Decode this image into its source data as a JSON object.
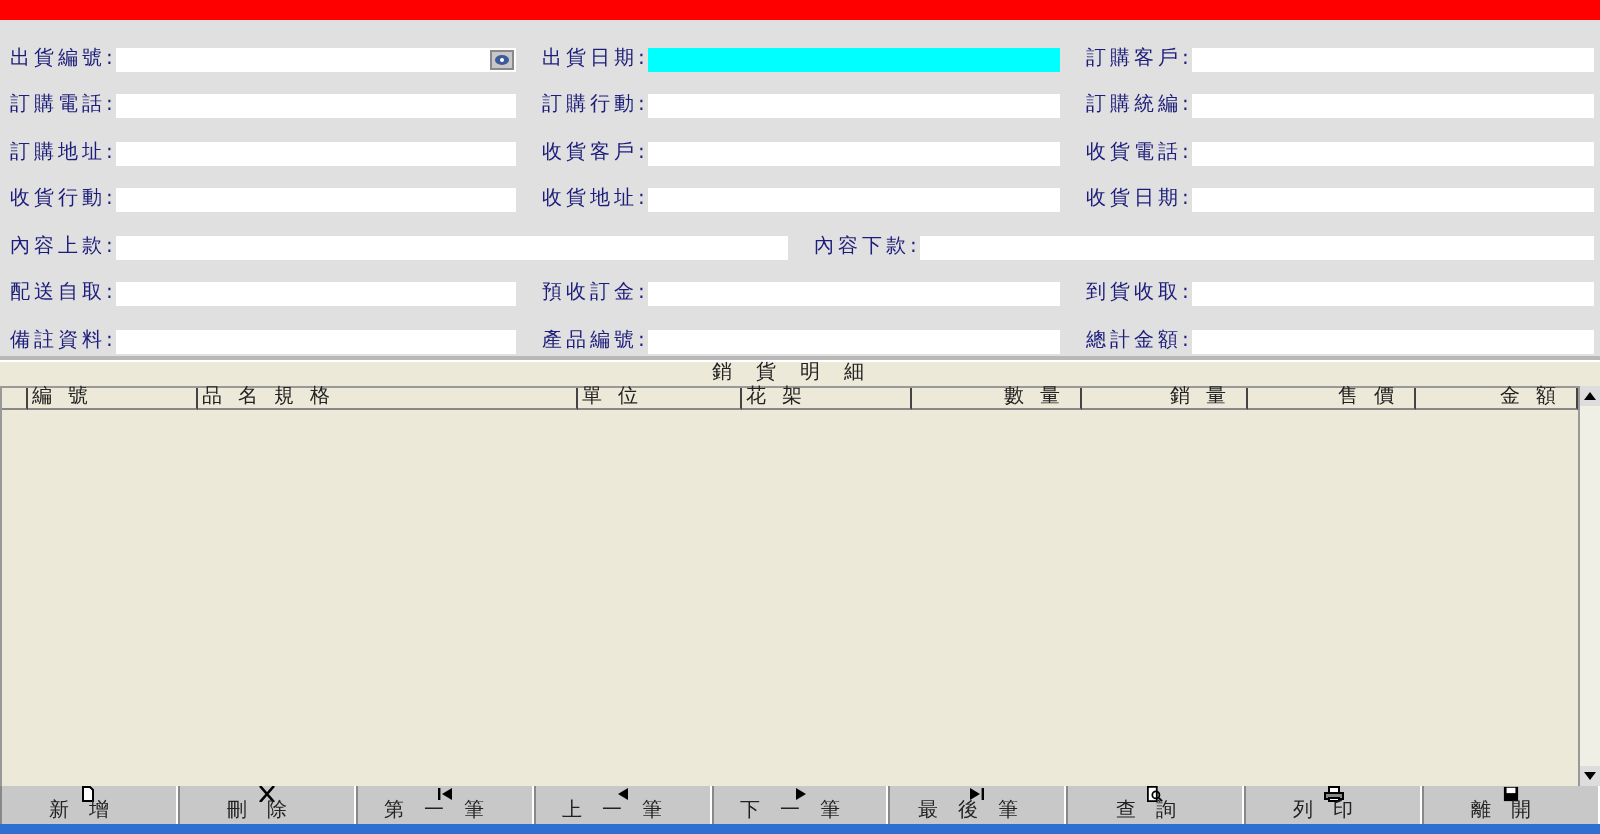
{
  "form": {
    "rows": [
      [
        {
          "label": "出貨編號:",
          "kind": "lookup",
          "highlighted": false
        },
        {
          "label": "出貨日期:",
          "kind": "text",
          "highlighted": true
        },
        {
          "label": "訂購客戶:",
          "kind": "text",
          "highlighted": false
        }
      ],
      [
        {
          "label": "訂購電話:",
          "kind": "text",
          "highlighted": false
        },
        {
          "label": "訂購行動:",
          "kind": "text",
          "highlighted": false
        },
        {
          "label": "訂購統編:",
          "kind": "text",
          "highlighted": false
        }
      ],
      [
        {
          "label": "訂購地址:",
          "kind": "text",
          "highlighted": false
        },
        {
          "label": "收貨客戶:",
          "kind": "text",
          "highlighted": false
        },
        {
          "label": "收貨電話:",
          "kind": "text",
          "highlighted": false
        }
      ],
      [
        {
          "label": "收貨行動:",
          "kind": "text",
          "highlighted": false
        },
        {
          "label": "收貨地址:",
          "kind": "text",
          "highlighted": false
        },
        {
          "label": "收貨日期:",
          "kind": "text",
          "highlighted": false
        }
      ],
      [
        {
          "label": "內容上款:",
          "kind": "text",
          "highlighted": false
        },
        {
          "label": "內容下款:",
          "kind": "text",
          "highlighted": false
        }
      ],
      [
        {
          "label": "配送自取:",
          "kind": "text",
          "highlighted": false
        },
        {
          "label": "預收訂金:",
          "kind": "text",
          "highlighted": false
        },
        {
          "label": "到貨收取:",
          "kind": "text",
          "highlighted": false
        }
      ],
      [
        {
          "label": "備註資料:",
          "kind": "text",
          "highlighted": false
        },
        {
          "label": "產品編號:",
          "kind": "text",
          "highlighted": false
        },
        {
          "label": "總計金額:",
          "kind": "text",
          "highlighted": false
        }
      ]
    ]
  },
  "table": {
    "title": "銷貨明細",
    "columns": [
      {
        "label": "編號",
        "kind": "text"
      },
      {
        "label": "品名規格",
        "kind": "text"
      },
      {
        "label": "單位",
        "kind": "text"
      },
      {
        "label": "花架",
        "kind": "text"
      },
      {
        "label": "數量",
        "kind": "number"
      },
      {
        "label": "銷量",
        "kind": "number"
      },
      {
        "label": "售價",
        "kind": "number"
      },
      {
        "label": "金額",
        "kind": "number"
      }
    ]
  },
  "toolbar": {
    "buttons": [
      "新增",
      "刪除",
      "第一筆",
      "上一筆",
      "下一筆",
      "最後筆",
      "查詢",
      "列印",
      "離開"
    ]
  }
}
